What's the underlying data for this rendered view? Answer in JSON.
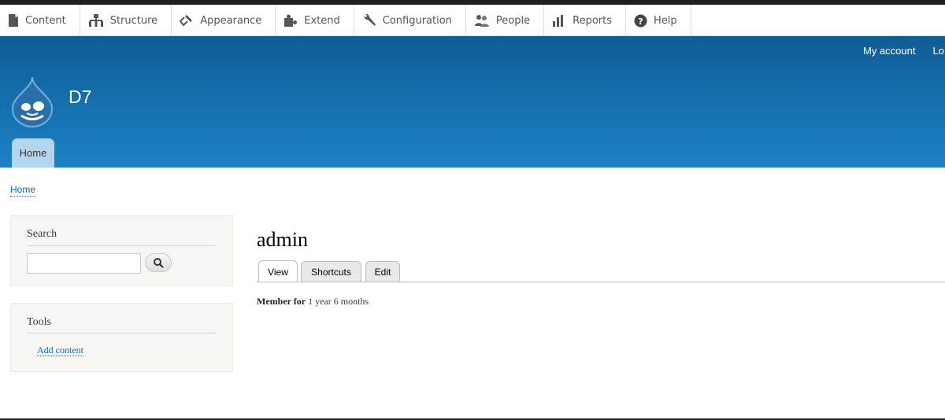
{
  "toolbar": {
    "items": [
      {
        "label": "Content",
        "icon": "file-icon"
      },
      {
        "label": "Structure",
        "icon": "sitemap-icon"
      },
      {
        "label": "Appearance",
        "icon": "paintbrush-icon"
      },
      {
        "label": "Extend",
        "icon": "puzzle-icon"
      },
      {
        "label": "Configuration",
        "icon": "wrench-icon"
      },
      {
        "label": "People",
        "icon": "people-icon"
      },
      {
        "label": "Reports",
        "icon": "bar-chart-icon"
      },
      {
        "label": "Help",
        "icon": "help-icon"
      }
    ]
  },
  "header": {
    "secondary_menu": [
      "My account",
      "Lo"
    ],
    "site_name": "D7",
    "primary_tab": "Home",
    "gradient_top": "#0e5c96",
    "gradient_bottom": "#1b82c4"
  },
  "breadcrumb": "Home",
  "sidebar": {
    "search_title": "Search",
    "search_value": "",
    "tools_title": "Tools",
    "tools_link": "Add content"
  },
  "main": {
    "title": "admin",
    "tabs": [
      "View",
      "Shortcuts",
      "Edit"
    ],
    "active_tab": "View",
    "member_label": "Member for",
    "member_value": "1 year 6 months"
  },
  "colors": {
    "link": "#0071b3"
  }
}
